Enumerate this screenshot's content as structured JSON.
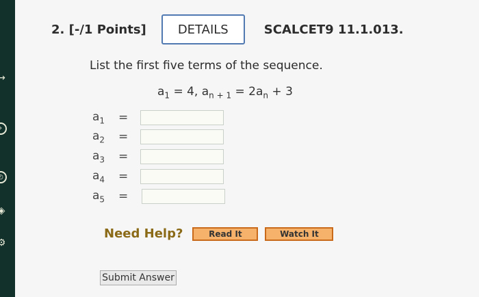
{
  "question": {
    "number": "2. [-/1 Points]",
    "details_label": "DETAILS",
    "code": "SCALCET9 11.1.013.",
    "prompt": "List the first five terms of the sequence.",
    "equation": {
      "a1_label": "a",
      "a1_sub": "1",
      "a1_value": " = 4,",
      "an1_label": "a",
      "an1_sub": "n + 1",
      "rhs": " = 2a",
      "rhs_sub": "n",
      "rhs_tail": " + 3"
    }
  },
  "terms": [
    {
      "label": "a",
      "sub": "1",
      "eq": "=",
      "value": ""
    },
    {
      "label": "a",
      "sub": "2",
      "eq": "=",
      "value": ""
    },
    {
      "label": "a",
      "sub": "3",
      "eq": "=",
      "value": ""
    },
    {
      "label": "a",
      "sub": "4",
      "eq": "=",
      "value": ""
    },
    {
      "label": "a",
      "sub": "5",
      "eq": "=",
      "value": ""
    }
  ],
  "help": {
    "need_help": "Need Help?",
    "read_it": "Read It",
    "watch_it": "Watch It"
  },
  "submit_label": "Submit Answer",
  "sidebar_icons": [
    "exit-icon",
    "clock-icon",
    "tag-icon",
    "gear-icon"
  ]
}
